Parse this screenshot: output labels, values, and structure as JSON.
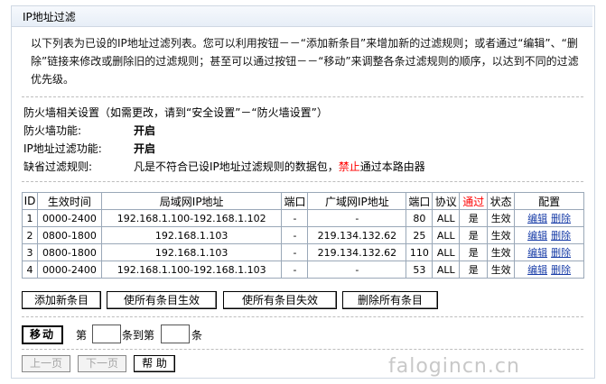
{
  "page_title": "IP地址过滤",
  "description": "以下列表为已设的IP地址过滤列表。您可以利用按钮－－“添加新条目”来增加新的过滤规则；或者通过“编辑”、“删除”链接来修改或删除旧的过滤规则；甚至可以通过按钮－－“移动”来调整各条过滤规则的顺序，以达到不同的过滤优先级。",
  "firewall": {
    "heading": "防火墙相关设置（如需更改，请到“安全设置”－“防火墙设置”）",
    "fw_label": "防火墙功能:",
    "fw_value": "开启",
    "ipf_label": "IP地址过滤功能:",
    "ipf_value": "开启",
    "default_label": "缺省过滤规则:",
    "default_pre": "凡是不符合已设IP地址过滤规则的数据包，",
    "default_red": "禁止",
    "default_post": "通过本路由器"
  },
  "table": {
    "headers": [
      "ID",
      "生效时间",
      "局域网IP地址",
      "端口",
      "广域网IP地址",
      "端口",
      "协议",
      "通过",
      "状态",
      "配置"
    ],
    "rows": [
      {
        "id": "1",
        "time": "0000-2400",
        "lan_ip": "192.168.1.100-192.168.1.102",
        "lan_port": "-",
        "wan_ip": "-",
        "wan_port": "80",
        "proto": "ALL",
        "pass": "是",
        "status": "生效",
        "edit": "编辑",
        "del": "删除"
      },
      {
        "id": "2",
        "time": "0800-1800",
        "lan_ip": "192.168.1.103",
        "lan_port": "-",
        "wan_ip": "219.134.132.62",
        "wan_port": "25",
        "proto": "ALL",
        "pass": "是",
        "status": "生效",
        "edit": "编辑",
        "del": "删除"
      },
      {
        "id": "3",
        "time": "0800-1800",
        "lan_ip": "192.168.1.103",
        "lan_port": "-",
        "wan_ip": "219.134.132.62",
        "wan_port": "110",
        "proto": "ALL",
        "pass": "是",
        "status": "生效",
        "edit": "编辑",
        "del": "删除"
      },
      {
        "id": "4",
        "time": "0000-2400",
        "lan_ip": "192.168.1.100-192.168.1.103",
        "lan_port": "-",
        "wan_ip": "-",
        "wan_port": "53",
        "proto": "ALL",
        "pass": "是",
        "status": "生效",
        "edit": "编辑",
        "del": "删除"
      }
    ]
  },
  "buttons": {
    "add": "添加新条目",
    "enable_all": "使所有条目生效",
    "disable_all": "使所有条目失效",
    "delete_all": "删除所有条目"
  },
  "move": {
    "button": "移动",
    "from_label": "第",
    "to_label": "条到第",
    "end_label": "条",
    "from_value": "",
    "to_value": ""
  },
  "nav": {
    "prev": "上一页",
    "next": "下一页",
    "help": "帮 助"
  },
  "watermark": "falogincn.cn",
  "colors": {
    "forbid": "#ff0000",
    "link": "#1a3ea8",
    "border": "#9aa8b8"
  }
}
